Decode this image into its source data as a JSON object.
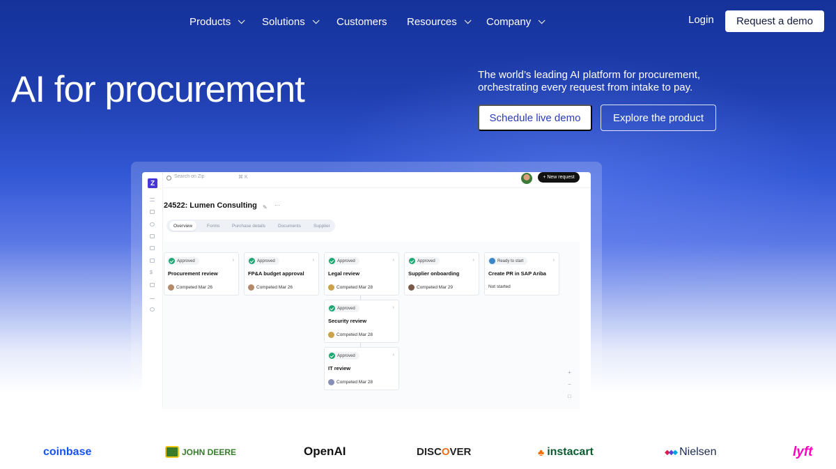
{
  "nav": {
    "items": [
      {
        "label": "Products",
        "dropdown": true
      },
      {
        "label": "Solutions",
        "dropdown": true
      },
      {
        "label": "Customers",
        "dropdown": false
      },
      {
        "label": "Resources",
        "dropdown": true
      },
      {
        "label": "Company",
        "dropdown": true
      }
    ],
    "login": "Login",
    "request_demo": "Request a demo"
  },
  "hero": {
    "title": "AI for procurement",
    "subtitle": "The world’s leading AI platform for procurement, orchestrating every request from intake to pay.",
    "cta_primary": "Schedule live demo",
    "cta_secondary": "Explore the product"
  },
  "app": {
    "logo": "Z",
    "search_placeholder": "Search on Zip",
    "search_shortcut": "⌘ K",
    "new_request": "+ New request",
    "doc_title": "24522: Lumen Consulting",
    "tabs": [
      "Overview",
      "Forms",
      "Purchase details",
      "Documents",
      "Supplier"
    ],
    "active_tab": "Overview",
    "cards": [
      {
        "status": "Approved",
        "title": "Procurement review",
        "meta": "Competed Mar 26"
      },
      {
        "status": "Approved",
        "title": "FP&A budget approval",
        "meta": "Competed Mar 26"
      },
      {
        "status": "Approved",
        "title": "Legal review",
        "meta": "Competed Mar 28"
      },
      {
        "status": "Approved",
        "title": "Supplier onboarding",
        "meta": "Competed Mar 29"
      },
      {
        "status": "Ready to start",
        "title": "Create PR in SAP Ariba",
        "meta": "Not started"
      },
      {
        "status": "Approved",
        "title": "Security review",
        "meta": "Competed Mar 28"
      },
      {
        "status": "Approved",
        "title": "IT review",
        "meta": "Competed Mar 28"
      }
    ],
    "zoom_in": "+",
    "zoom_out": "−",
    "fit": "□"
  },
  "logos": {
    "coinbase": "coinbase",
    "johndeere": "JOHN DEERE",
    "openai": "OpenAI",
    "discover_a": "DISC",
    "discover_o": "O",
    "discover_b": "VER",
    "instacart": "instacart",
    "nielsen": "Nielsen",
    "lyft": "lyft"
  },
  "colors": {
    "accent": "#2a3bb8",
    "approved_green": "#1ea672",
    "brand_purple": "#4636d6"
  }
}
